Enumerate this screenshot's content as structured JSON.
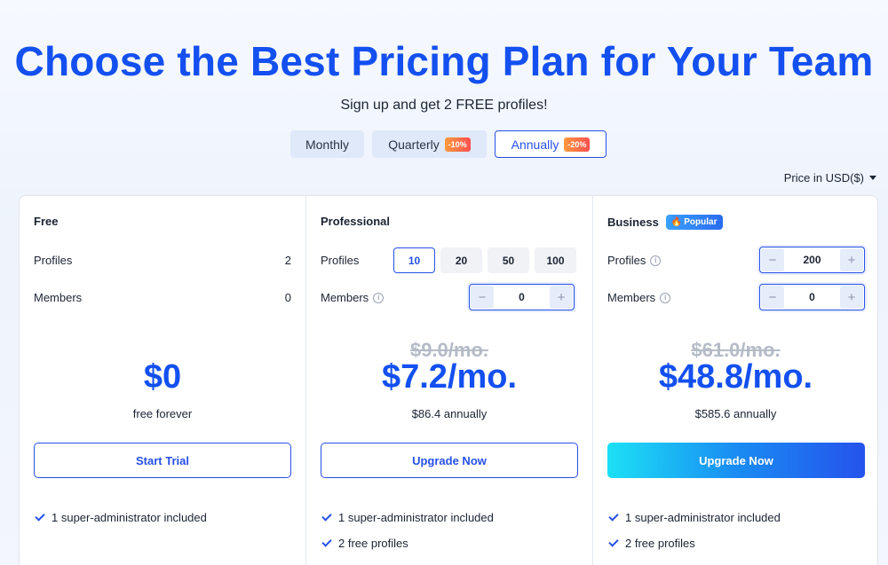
{
  "header": {
    "title": "Choose the Best Pricing Plan for Your Team",
    "subtitle": "Sign up and get 2 FREE profiles!"
  },
  "billing": {
    "monthly": "Monthly",
    "quarterly": "Quarterly",
    "quarterly_discount": "-10%",
    "annually": "Annually",
    "annually_discount": "-20%",
    "selected": "Annually"
  },
  "currency": {
    "label": "Price in USD($)"
  },
  "colors": {
    "accent": "#1450f0",
    "border": "#2650e8"
  },
  "plans": {
    "free": {
      "name": "Free",
      "profiles_label": "Profiles",
      "profiles_value": "2",
      "members_label": "Members",
      "members_value": "0",
      "price": "$0",
      "price_note": "free forever",
      "cta": "Start Trial",
      "features": [
        "1 super-administrator included"
      ]
    },
    "professional": {
      "name": "Professional",
      "profiles_label": "Profiles",
      "profile_options": [
        "10",
        "20",
        "50",
        "100"
      ],
      "profile_selected": "10",
      "members_label": "Members",
      "members_value": "0",
      "old_price": "$9.0/mo.",
      "price": "$7.2/mo.",
      "price_note": "$86.4 annually",
      "cta": "Upgrade Now",
      "features": [
        "1 super-administrator included",
        "2 free profiles"
      ]
    },
    "business": {
      "name": "Business",
      "badge": "Popular",
      "profiles_label": "Profiles",
      "profiles_value": "200",
      "members_label": "Members",
      "members_value": "0",
      "old_price": "$61.0/mo.",
      "price": "$48.8/mo.",
      "price_note": "$585.6 annually",
      "cta": "Upgrade Now",
      "features": [
        "1 super-administrator included",
        "2 free profiles"
      ]
    }
  },
  "icons": {
    "minus": "−",
    "plus": "+",
    "info": "i",
    "flame": "🔥"
  }
}
